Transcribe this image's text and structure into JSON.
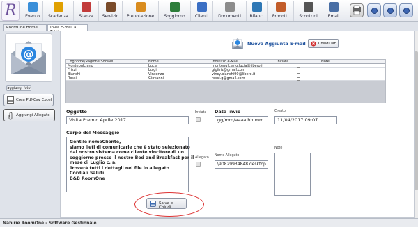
{
  "toolbar": {
    "items": [
      {
        "label": "Evento",
        "icon": "event-icon",
        "color": "#3a8fd9"
      },
      {
        "label": "Scadenza",
        "icon": "deadline-icon",
        "color": "#e0a000"
      },
      {
        "label": "Stanze",
        "icon": "rooms-icon",
        "color": "#c23b3b"
      },
      {
        "label": "Servizio",
        "icon": "service-icon",
        "color": "#7a4b2a"
      },
      {
        "label": "Prenotazione",
        "icon": "booking-icon",
        "color": "#d98c1f"
      },
      {
        "label": "Soggiorno",
        "icon": "stay-icon",
        "color": "#2d7d3a"
      },
      {
        "label": "Clienti",
        "icon": "clients-icon",
        "color": "#3b6fc4"
      },
      {
        "label": "Documenti",
        "icon": "documents-icon",
        "color": "#8c8c8c"
      },
      {
        "label": "Bilanci",
        "icon": "balance-icon",
        "color": "#2f78b5"
      },
      {
        "label": "Prodotti",
        "icon": "products-icon",
        "color": "#c25d2a"
      },
      {
        "label": "Scontrini",
        "icon": "receipts-icon",
        "color": "#555555"
      },
      {
        "label": "Email",
        "icon": "email-icon",
        "color": "#4a6fa5"
      }
    ]
  },
  "tabs": [
    {
      "label": "RoomOne Home"
    },
    {
      "label": "Invia E-mail a Tutti"
    }
  ],
  "left": {
    "upload_label": "aggiungi foto",
    "excel_label": "Crea Pdf-Csv Excel",
    "attach_label": "Aggiungi Allegato"
  },
  "header": {
    "title": "Nuova Aggiunta E-mail",
    "close_label": "Chiudi Tab"
  },
  "table": {
    "columns": [
      "Cognome/Ragione Sociale",
      "Nome",
      "Indirizzo e-Mail",
      "Inviata",
      "Note"
    ],
    "rows": [
      {
        "surname": "Montepulciano",
        "name": "Lucia",
        "email": "montepulciano.lucia@libero.it"
      },
      {
        "surname": "Frizzi",
        "name": "Luigi",
        "email": "gigifriz@gmail.com"
      },
      {
        "surname": "Bianchi",
        "name": "Vincenzo",
        "email": "vincy.bianchi90@libero.it"
      },
      {
        "surname": "Rossi",
        "name": "Giovanni",
        "email": "rossi.g@gmail.com"
      }
    ]
  },
  "form": {
    "subject_label": "Oggetto",
    "subject_value": "Visita Premio Aprile 2017",
    "sent_label": "Inviata",
    "send_date_label": "Data invio",
    "send_date_value": "gg/mm/aaaa hh:mm",
    "created_label": "Creato",
    "created_value": "11/04/2017 09:07",
    "body_label": "Corpo del Messaggio",
    "body_lines": [
      "Gentile nomeCliente,",
      "siamo lieti di comunicarle che è stato selezionato",
      "dal nostro sistema come cliente vincitore di un",
      "soggiorno presso il nostro Bed and Breakfast per il",
      "mese di Luglio c. a.",
      "Troverà tutti i dettagli nel file in allegato",
      "Cordiali Saluti",
      "B&B RoomOne"
    ],
    "attachment_label": "Allegato",
    "attachment_name_label": "Nome Allegato",
    "attachment_name_value": "\\90829934848.desktop",
    "notes_label": "Note",
    "save_label": "Salva e Chiudi"
  },
  "footer": {
    "text": "Nabirie RoomOne - Software Gestionale"
  }
}
